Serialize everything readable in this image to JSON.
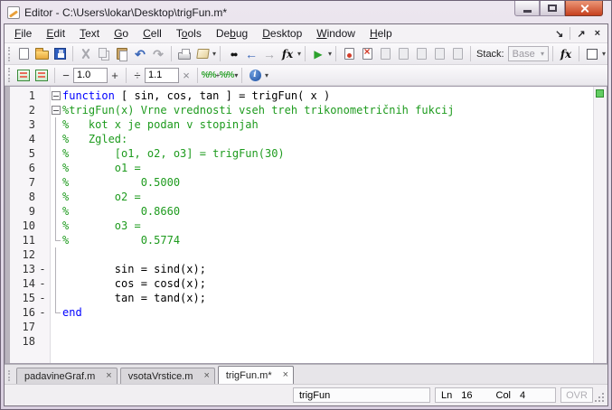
{
  "window": {
    "title": "Editor - C:\\Users\\lokar\\Desktop\\trigFun.m*"
  },
  "menu": {
    "items": [
      {
        "label": "File",
        "m": 0
      },
      {
        "label": "Edit",
        "m": 0
      },
      {
        "label": "Text",
        "m": 0
      },
      {
        "label": "Go",
        "m": 0
      },
      {
        "label": "Cell",
        "m": 0
      },
      {
        "label": "Tools",
        "m": 1
      },
      {
        "label": "Debug",
        "m": 2
      },
      {
        "label": "Desktop",
        "m": 0
      },
      {
        "label": "Window",
        "m": 0
      },
      {
        "label": "Help",
        "m": 0
      }
    ]
  },
  "icons": {
    "undo": "↶",
    "redo": "↷",
    "back": "←",
    "forward": "→",
    "run": "▶",
    "caret": "▾",
    "dock": "↘",
    "undock": "↗",
    "menu_close": "×",
    "find": "●●",
    "tab_close": "×",
    "info": "i"
  },
  "toolbar": {
    "stack_label": "Stack:",
    "stack_value": "Base",
    "fx": "fx"
  },
  "cell_toolbar": {
    "decrement": "−",
    "increment": "+",
    "value_step": "1.0",
    "divide": "÷",
    "multiply": "×",
    "factor_step": "1.1",
    "percent": "%%",
    "plus_small": "+"
  },
  "editor": {
    "lines": [
      {
        "n": "1",
        "d": "",
        "f": "box",
        "seg": [
          {
            "c": "kw",
            "t": "function"
          },
          {
            "c": "pl",
            "t": " [ sin, cos, tan ] = trigFun( x )"
          }
        ]
      },
      {
        "n": "2",
        "d": "",
        "f": "box",
        "seg": [
          {
            "c": "cm",
            "t": "%trigFun(x) Vrne vrednosti vseh treh trikonometričnih fukcij"
          }
        ]
      },
      {
        "n": "3",
        "d": "",
        "f": "bar",
        "seg": [
          {
            "c": "cm",
            "t": "%   kot x je podan v stopinjah"
          }
        ]
      },
      {
        "n": "4",
        "d": "",
        "f": "bar",
        "seg": [
          {
            "c": "cm",
            "t": "%   Zgled:"
          }
        ]
      },
      {
        "n": "5",
        "d": "",
        "f": "bar",
        "seg": [
          {
            "c": "cm",
            "t": "%       [o1, o2, o3] = trigFun(30)"
          }
        ]
      },
      {
        "n": "6",
        "d": "",
        "f": "bar",
        "seg": [
          {
            "c": "cm",
            "t": "%       o1 ="
          }
        ]
      },
      {
        "n": "7",
        "d": "",
        "f": "bar",
        "seg": [
          {
            "c": "cm",
            "t": "%           0.5000"
          }
        ]
      },
      {
        "n": "8",
        "d": "",
        "f": "bar",
        "seg": [
          {
            "c": "cm",
            "t": "%       o2 ="
          }
        ]
      },
      {
        "n": "9",
        "d": "",
        "f": "bar",
        "seg": [
          {
            "c": "cm",
            "t": "%           0.8660"
          }
        ]
      },
      {
        "n": "10",
        "d": "",
        "f": "bar",
        "seg": [
          {
            "c": "cm",
            "t": "%       o3 ="
          }
        ]
      },
      {
        "n": "11",
        "d": "",
        "f": "end",
        "seg": [
          {
            "c": "cm",
            "t": "%           0.5774"
          }
        ]
      },
      {
        "n": "12",
        "d": "",
        "f": "bar",
        "seg": []
      },
      {
        "n": "13",
        "d": "-",
        "f": "bar",
        "seg": [
          {
            "c": "pl",
            "t": "        sin = sind(x);"
          }
        ]
      },
      {
        "n": "14",
        "d": "-",
        "f": "bar",
        "seg": [
          {
            "c": "pl",
            "t": "        cos = cosd(x);"
          }
        ]
      },
      {
        "n": "15",
        "d": "-",
        "f": "bar",
        "seg": [
          {
            "c": "pl",
            "t": "        tan = tand(x);"
          }
        ]
      },
      {
        "n": "16",
        "d": "-",
        "f": "end",
        "seg": [
          {
            "c": "kw",
            "t": "end"
          }
        ]
      },
      {
        "n": "17",
        "d": "",
        "f": "",
        "seg": []
      },
      {
        "n": "18",
        "d": "",
        "f": "",
        "seg": []
      }
    ]
  },
  "tabs": [
    {
      "label": "padavineGraf.m",
      "active": false
    },
    {
      "label": "vsotaVrstice.m",
      "active": false
    },
    {
      "label": "trigFun.m*",
      "active": true
    }
  ],
  "status": {
    "function_name": "trigFun",
    "ln_label": "Ln",
    "ln_value": "16",
    "col_label": "Col",
    "col_value": "4",
    "ovr": "OVR"
  },
  "colors": {
    "keyword": "#0000ff",
    "comment": "#1e9b1e",
    "lint_ok_green": "#63cd63",
    "titlebar_lavender": "#e4dce8",
    "close_button_red": "#c6401f"
  }
}
